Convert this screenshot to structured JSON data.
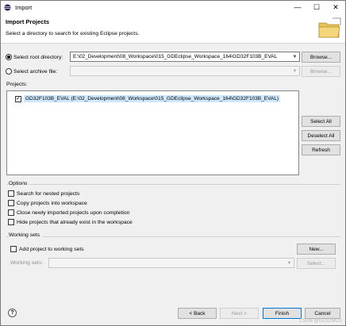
{
  "window": {
    "title": "Import",
    "controls": {
      "minimize": "—",
      "maximize": "☐",
      "close": "✕"
    }
  },
  "banner": {
    "title": "Import Projects",
    "description": "Select a directory to search for existing Eclipse projects."
  },
  "source": {
    "root_dir_label": "Select root directory:",
    "root_dir_value": "E:\\02_Development\\08_Workspace\\015_GDEclipse_Workspace_164\\GD32F103B_EVAL",
    "root_dir_selected": true,
    "archive_label": "Select archive file:",
    "archive_value": "",
    "browse_label": "Browse..."
  },
  "projects": {
    "label": "Projects:",
    "items": [
      {
        "name": "GD32F103B_EVAL (E:\\02_Development\\08_Workspace\\015_GDEclipse_Workspace_164\\GD32F103B_EVAL)",
        "checked": true
      }
    ],
    "select_all": "Select All",
    "deselect_all": "Deselect All",
    "refresh": "Refresh"
  },
  "options": {
    "title": "Options",
    "items": [
      {
        "label": "Search for nested projects",
        "checked": false
      },
      {
        "label": "Copy projects into workspace",
        "checked": false
      },
      {
        "label": "Close newly imported projects upon completion",
        "checked": false
      },
      {
        "label": "Hide projects that already exist in the workspace",
        "checked": false
      }
    ]
  },
  "working_sets": {
    "title": "Working sets",
    "add_label": "Add project to working sets",
    "add_checked": false,
    "new_label": "New...",
    "sets_label": "Working sets:",
    "sets_value": "",
    "select_label": "Select..."
  },
  "footer": {
    "help": "?",
    "back": "< Back",
    "next": "Next >",
    "finish": "Finish",
    "cancel": "Cancel",
    "watermark": "CSDN @GD32MCU"
  },
  "colors": {
    "selection": "#cde8ff",
    "default_button_border": "#0078d7",
    "window_bg": "#f0f0f0"
  }
}
